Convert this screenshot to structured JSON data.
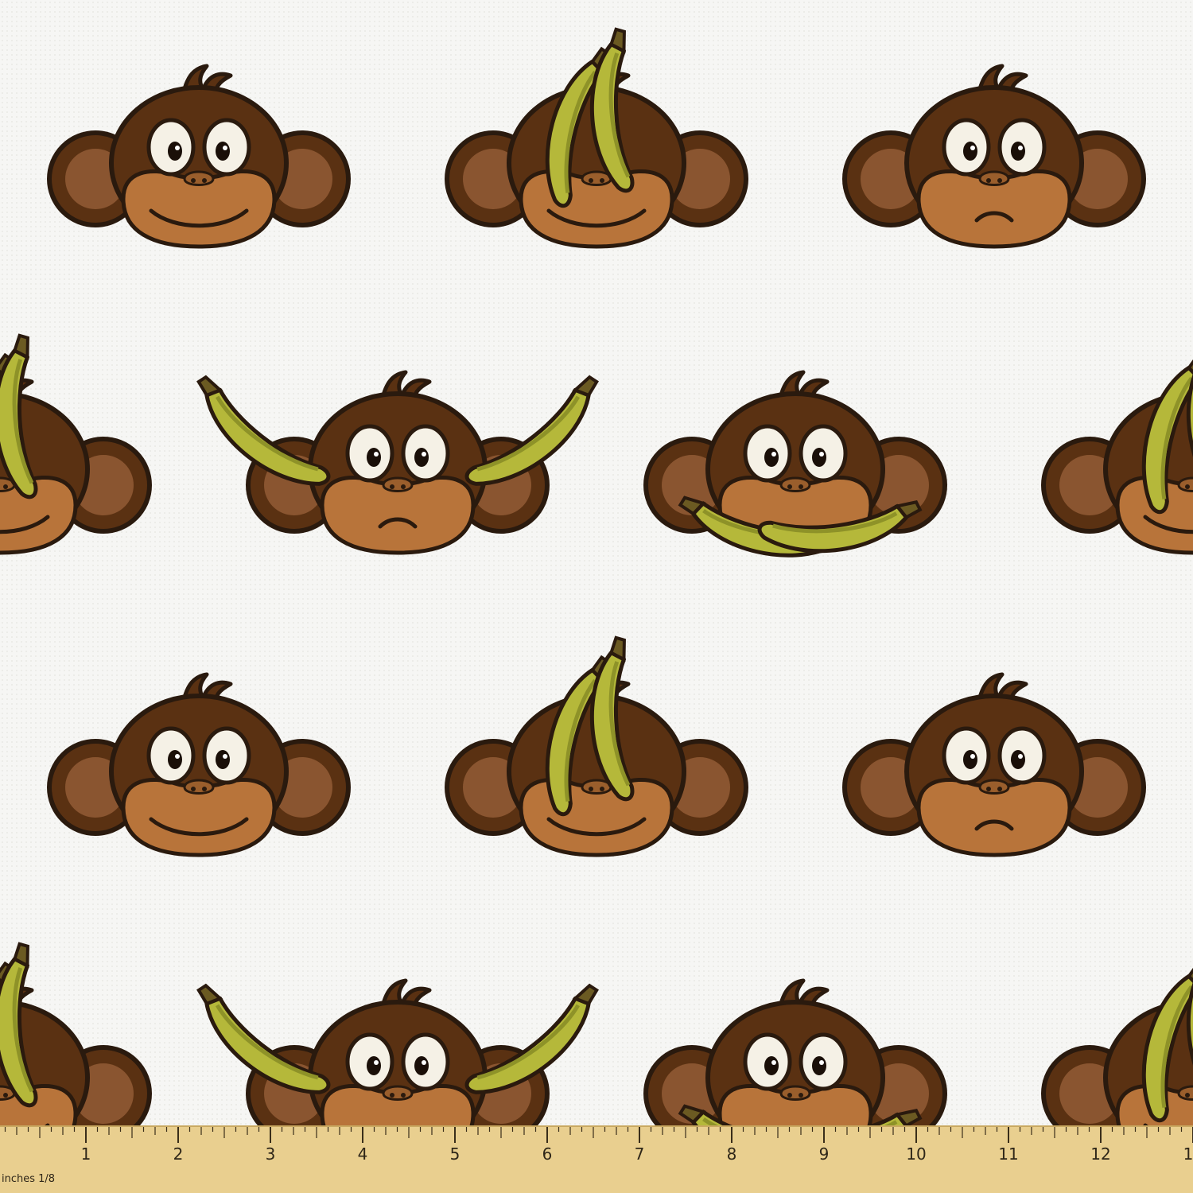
{
  "pattern": {
    "subject": "monkey-face",
    "rows": [
      [
        "plain-smile",
        "banana-on-head",
        "plain-frown"
      ],
      [
        "banana-on-head",
        "banana-ears",
        "banana-in-mouth",
        "banana-on-head"
      ],
      [
        "plain-smile",
        "banana-on-head",
        "plain-frown"
      ],
      [
        "banana-on-head",
        "banana-ears",
        "banana-in-mouth",
        "banana-on-head"
      ]
    ],
    "colors": {
      "background": "#f6f6f4",
      "fur": "#5a3112",
      "outline": "#2a1a0e",
      "face": "#b8743a",
      "ear_inner": "#8a5530",
      "banana": "#b5b83a",
      "ruler": "#e9cf8f"
    }
  },
  "ruler": {
    "numbers": [
      "1",
      "2",
      "3",
      "4",
      "5",
      "6",
      "7",
      "8",
      "9",
      "10",
      "11",
      "12",
      "1"
    ],
    "units_label": "inches 1/8"
  }
}
